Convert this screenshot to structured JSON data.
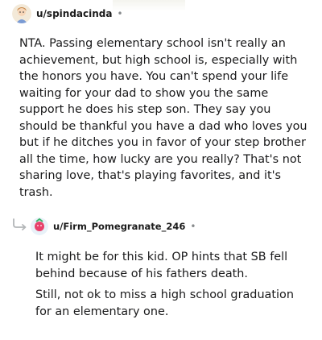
{
  "comment": {
    "username": "u/spindacinda",
    "separator": "•",
    "body": "NTA. Passing elementary school isn't really an achievement, but high school is, especially with the honors you have. You can't spend your life waiting for your dad to show you the same support he does his step son. They say you should be thankful you have a dad who loves you but if he ditches you in favor of your step brother all the time, how lucky are you really? That's not sharing love, that's playing favorites, and it's trash."
  },
  "reply": {
    "username": "u/Firm_Pomegranate_246",
    "separator": "•",
    "paragraphs": [
      "It might be for this kid. OP hints that SB fell behind because of his fathers death.",
      "Still, not ok to miss a high school graduation for an elementary one."
    ]
  }
}
